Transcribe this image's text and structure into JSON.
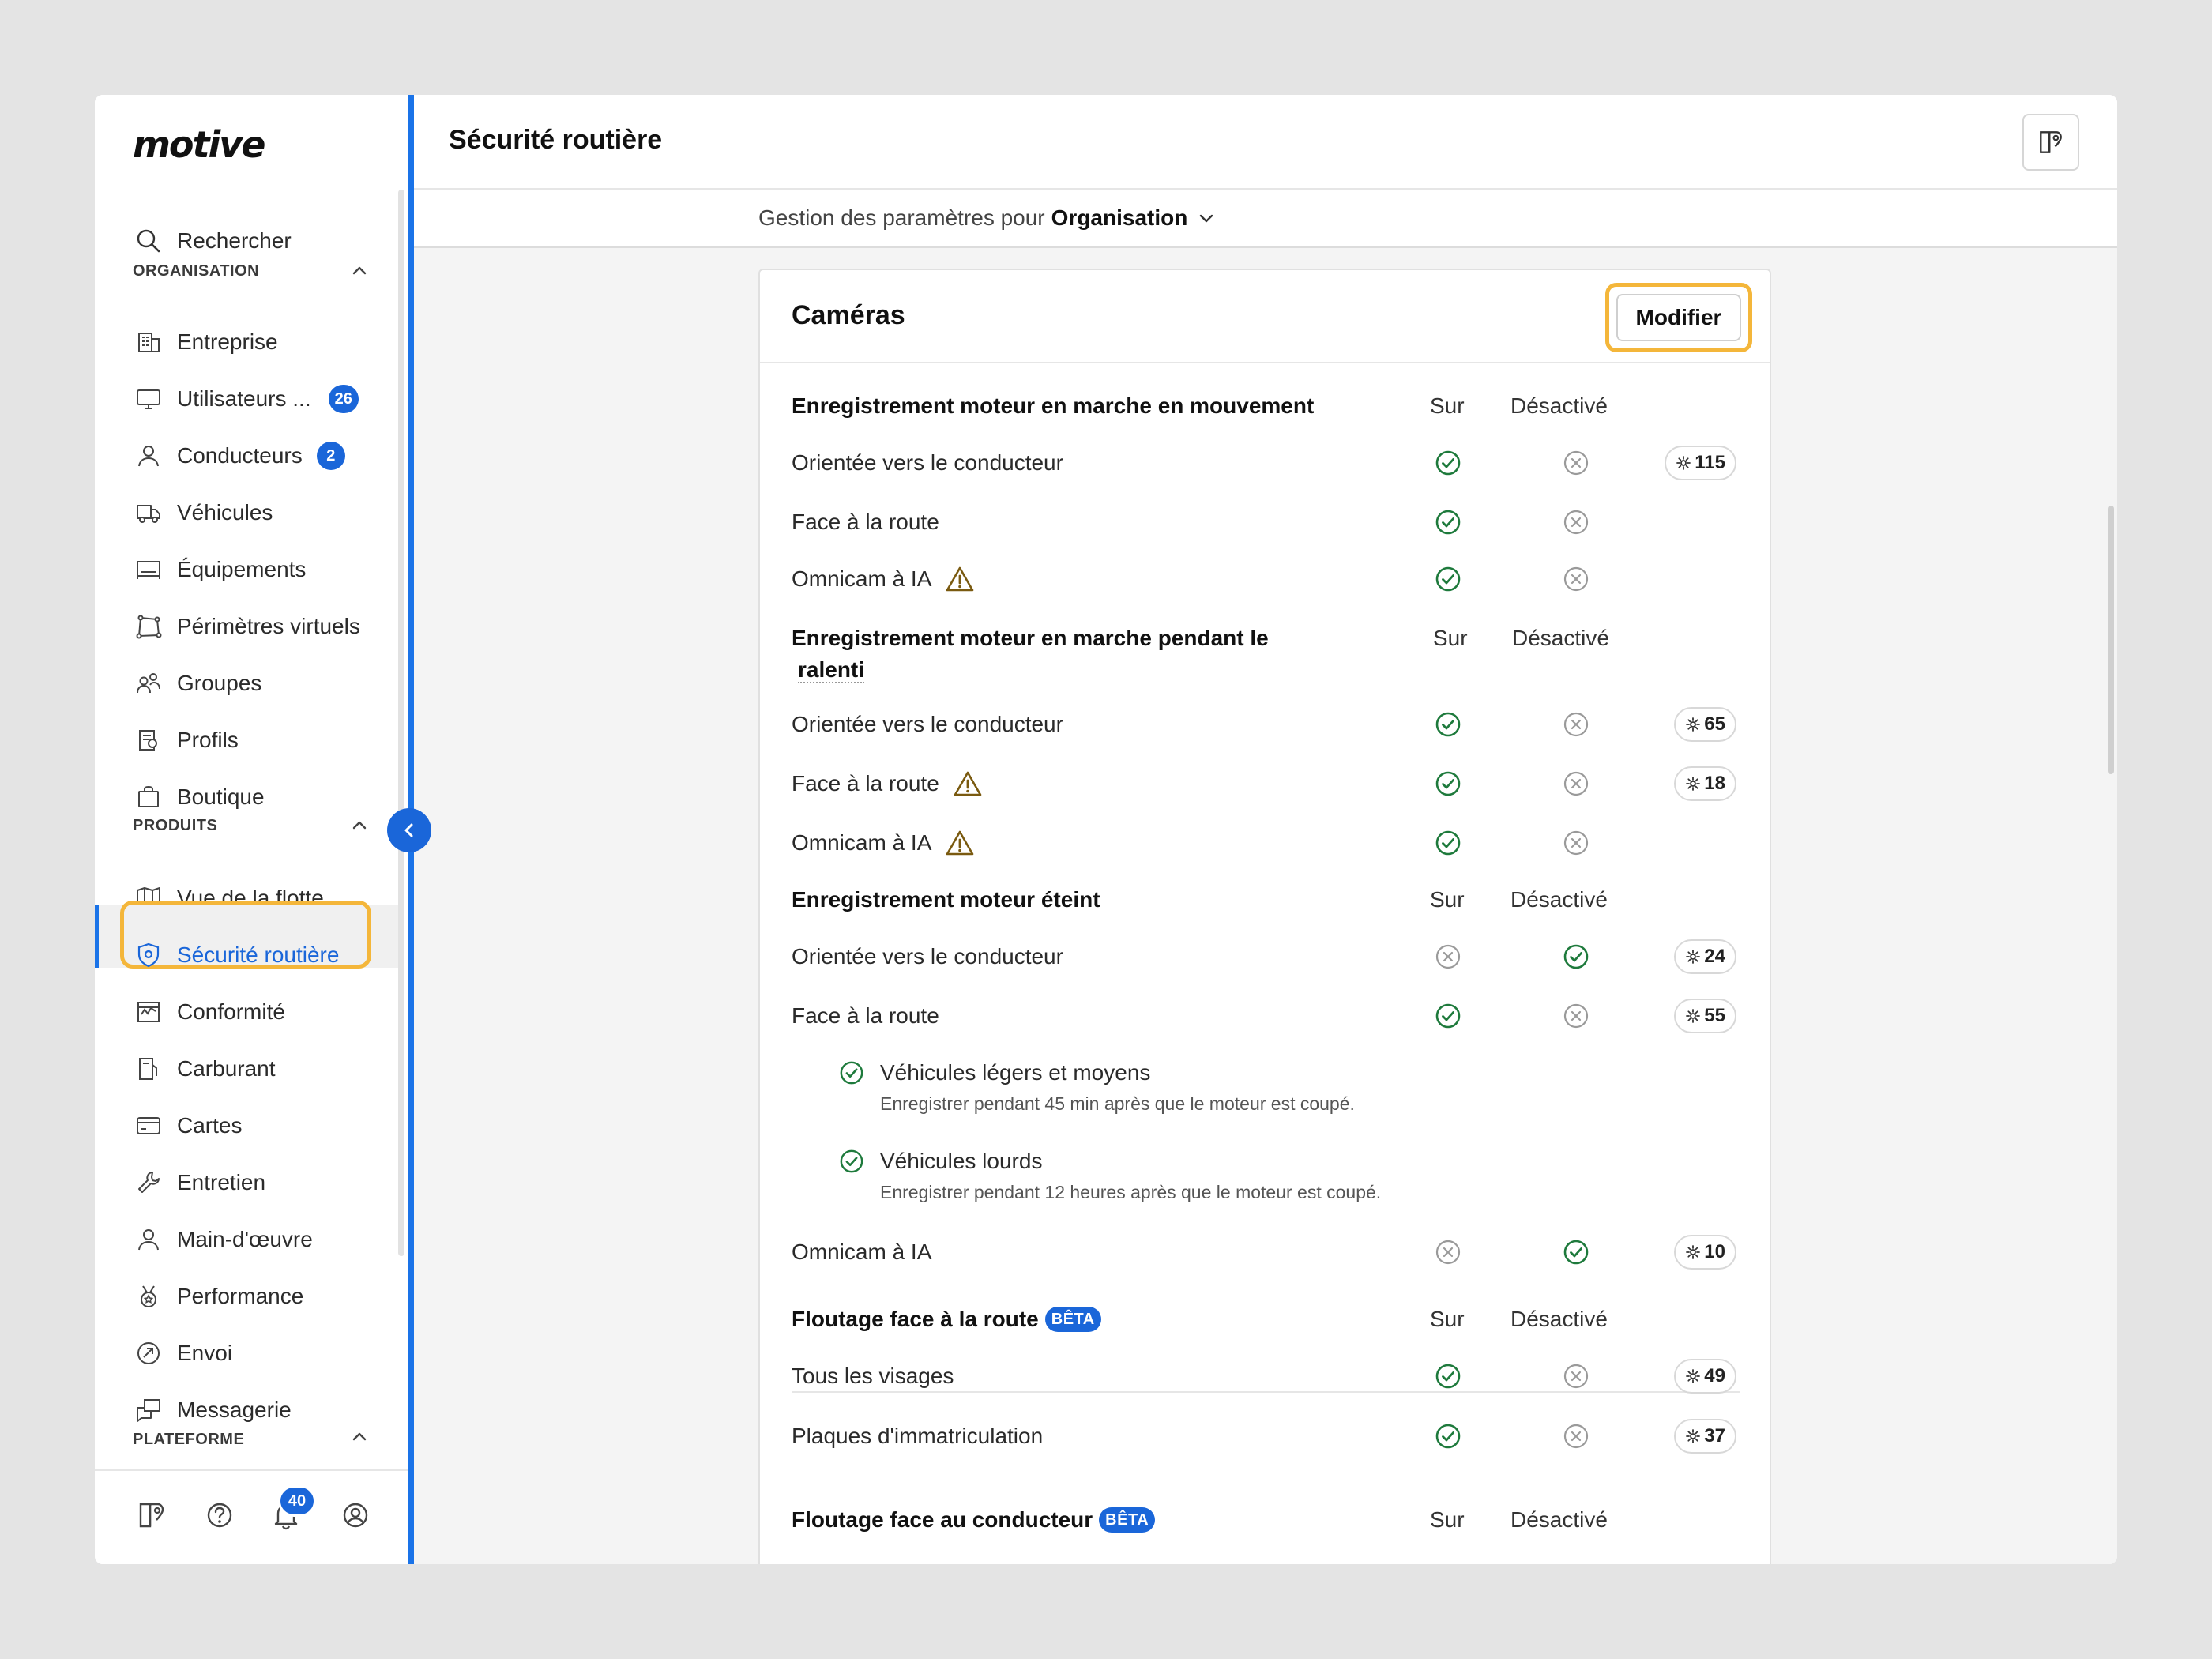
{
  "app": {
    "logo": "motive",
    "page_title": "Sécurité routière"
  },
  "sidebar": {
    "search_label": "Rechercher",
    "sections": {
      "organisation": "ORGANISATION",
      "produits": "PRODUITS",
      "plateforme": "PLATEFORME"
    },
    "items": {
      "entreprise": "Entreprise",
      "utilisateurs": "Utilisateurs ...",
      "utilisateurs_badge": "26",
      "conducteurs": "Conducteurs",
      "conducteurs_badge": "2",
      "vehicules": "Véhicules",
      "equipements": "Équipements",
      "perimetres": "Périmètres virtuels",
      "groupes": "Groupes",
      "profils": "Profils",
      "boutique": "Boutique",
      "vue_flotte": "Vue de la flotte",
      "securite": "Sécurité routière",
      "conformite": "Conformité",
      "carburant": "Carburant",
      "cartes": "Cartes",
      "entretien": "Entretien",
      "main_oeuvre": "Main-d'œuvre",
      "performance": "Performance",
      "envoi": "Envoi",
      "messagerie": "Messagerie"
    },
    "footer": {
      "notifications_badge": "40"
    }
  },
  "subheader": {
    "prefix": "Gestion des paramètres pour",
    "scope": "Organisation"
  },
  "card": {
    "title": "Caméras",
    "modify_label": "Modifier",
    "col_on": "Sur",
    "col_off": "Désactivé",
    "beta": "BÊTA",
    "sections": {
      "moving": {
        "title": "Enregistrement moteur en marche en mouvement",
        "rows": [
          {
            "label": "Orientée vers le conducteur",
            "count": "115"
          },
          {
            "label": "Face à la route"
          },
          {
            "label": "Omnicam à IA"
          }
        ]
      },
      "idle": {
        "title_line1": "Enregistrement moteur en marche pendant le",
        "title_line2": "ralenti",
        "rows": [
          {
            "label": "Orientée vers le conducteur",
            "count": "65"
          },
          {
            "label": "Face à la route",
            "count": "18"
          },
          {
            "label": "Omnicam à IA"
          }
        ]
      },
      "off": {
        "title": "Enregistrement moteur éteint",
        "rows": [
          {
            "label": "Orientée vers le conducteur",
            "count": "24"
          },
          {
            "label": "Face à la route",
            "count": "55"
          },
          {
            "label": "Omnicam à IA",
            "count": "10"
          }
        ],
        "sub_options": [
          {
            "label": "Véhicules légers et moyens",
            "desc": "Enregistrer pendant 45 min après que le moteur est coupé."
          },
          {
            "label": "Véhicules lourds",
            "desc": "Enregistrer pendant 12 heures après que le moteur est coupé."
          }
        ]
      },
      "blur_road": {
        "title": "Floutage face à la route",
        "rows": [
          {
            "label": "Tous les visages",
            "count": "49"
          },
          {
            "label": "Plaques d'immatriculation",
            "count": "37"
          }
        ]
      },
      "blur_driver": {
        "title": "Floutage face au conducteur"
      }
    }
  },
  "colors": {
    "accent": "#1a66d9",
    "highlight": "#f4b63a",
    "on_green": "#1e7a3c",
    "off_gray": "#9a9a9a",
    "warn": "#7a5a10"
  }
}
